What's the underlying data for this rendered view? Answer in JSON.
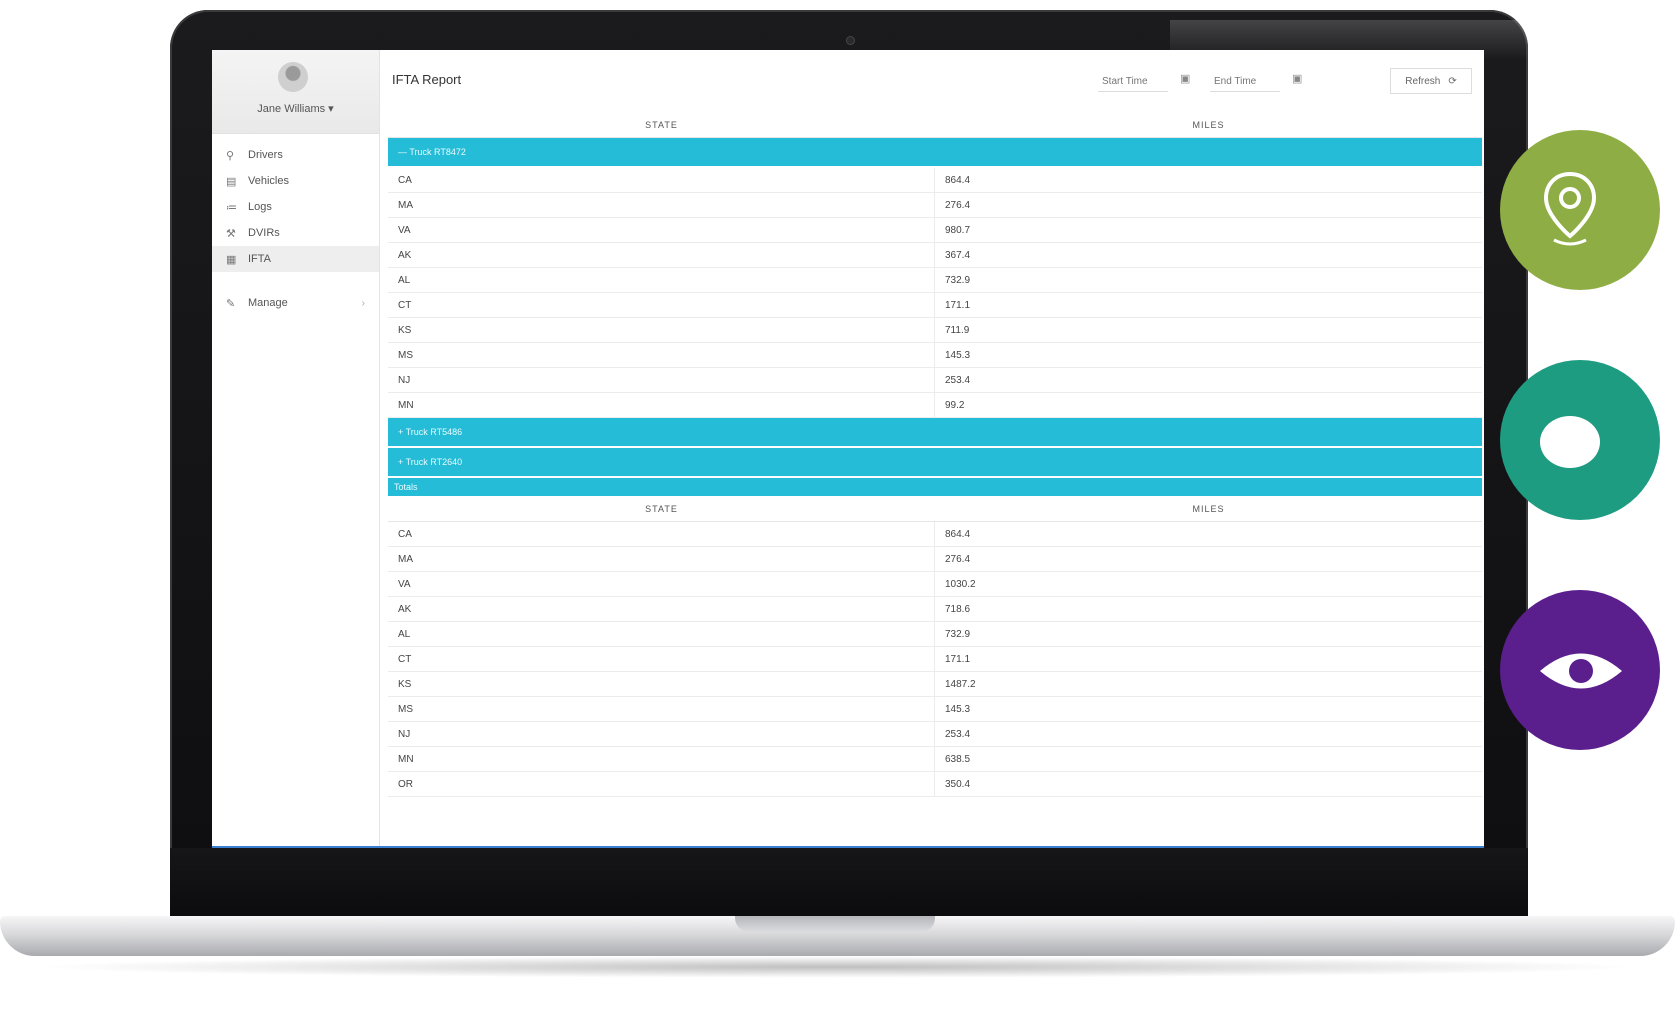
{
  "app": {
    "page_title": "IFTA Report",
    "user_name": "Jane Williams ▾"
  },
  "sidebar": {
    "items": [
      {
        "label": "Drivers",
        "icon": "person-icon",
        "glyph": "⚲"
      },
      {
        "label": "Vehicles",
        "icon": "truck-icon",
        "glyph": "▤"
      },
      {
        "label": "Logs",
        "icon": "logs-icon",
        "glyph": "≔"
      },
      {
        "label": "DVIRs",
        "icon": "wrench-icon",
        "glyph": "⚒"
      },
      {
        "label": "IFTA",
        "icon": "document-icon",
        "glyph": "▦"
      }
    ],
    "manage": {
      "label": "Manage",
      "icon": "pencil-icon",
      "glyph": "✎",
      "chevron": "›"
    }
  },
  "toolbar": {
    "start_placeholder": "Start Time",
    "end_placeholder": "End Time",
    "refresh_label": "Refresh",
    "refresh_glyph": "⟳",
    "calendar_glyph": "▣"
  },
  "table": {
    "header_state": "STATE",
    "header_miles": "MILES",
    "groups": [
      {
        "label": "— Truck RT8472",
        "rows": [
          {
            "state": "CA",
            "miles": "864.4"
          },
          {
            "state": "MA",
            "miles": "276.4"
          },
          {
            "state": "VA",
            "miles": "980.7"
          },
          {
            "state": "AK",
            "miles": "367.4"
          },
          {
            "state": "AL",
            "miles": "732.9"
          },
          {
            "state": "CT",
            "miles": "171.1"
          },
          {
            "state": "KS",
            "miles": "711.9"
          },
          {
            "state": "MS",
            "miles": "145.3"
          },
          {
            "state": "NJ",
            "miles": "253.4"
          },
          {
            "state": "MN",
            "miles": "99.2"
          }
        ]
      },
      {
        "label": "+ Truck RT5486",
        "rows": []
      },
      {
        "label": "+ Truck RT2640",
        "rows": []
      }
    ],
    "totals_label": "Totals",
    "totals_rows": [
      {
        "state": "CA",
        "miles": "864.4"
      },
      {
        "state": "MA",
        "miles": "276.4"
      },
      {
        "state": "VA",
        "miles": "1030.2"
      },
      {
        "state": "AK",
        "miles": "718.6"
      },
      {
        "state": "AL",
        "miles": "732.9"
      },
      {
        "state": "CT",
        "miles": "171.1"
      },
      {
        "state": "KS",
        "miles": "1487.2"
      },
      {
        "state": "MS",
        "miles": "145.3"
      },
      {
        "state": "NJ",
        "miles": "253.4"
      },
      {
        "state": "MN",
        "miles": "638.5"
      },
      {
        "state": "OR",
        "miles": "350.4"
      }
    ]
  },
  "features": [
    {
      "icon": "map-pin-icon",
      "color": "#8eae45"
    },
    {
      "icon": "chat-bubble-icon",
      "color": "#1e9c82"
    },
    {
      "icon": "eye-icon",
      "color": "#5a1f8c"
    }
  ],
  "colors": {
    "accent": "#24bcd6",
    "laptop_frame": "#111113"
  }
}
